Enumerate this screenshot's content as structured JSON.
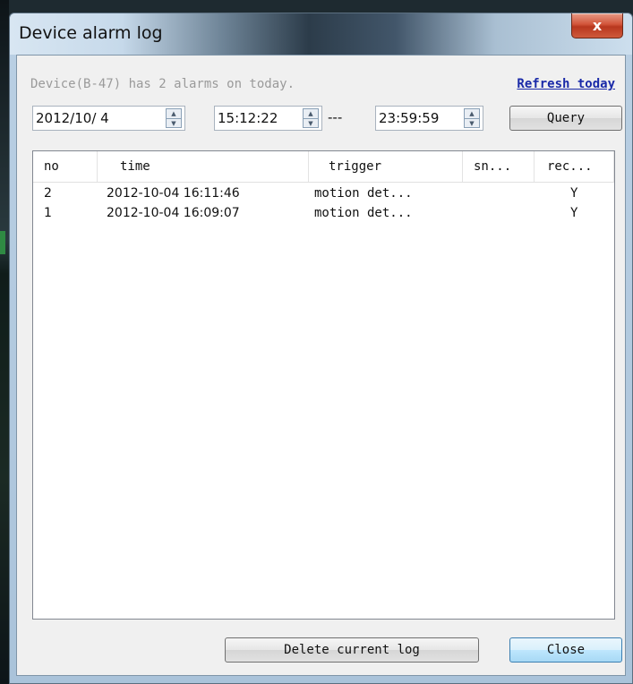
{
  "window": {
    "title": "Device alarm log",
    "close_glyph": "x"
  },
  "info": {
    "summary": "Device(B-47) has 2 alarms on today.",
    "refresh_link": "Refresh today"
  },
  "query": {
    "date": "2012/10/ 4",
    "start_time": "15:12:22",
    "separator": "---",
    "end_time": "23:59:59",
    "query_button": "Query"
  },
  "table": {
    "columns": [
      "no",
      "time",
      "trigger",
      "sn...",
      "rec..."
    ],
    "rows": [
      {
        "no": "2",
        "time": "2012-10-04 16:11:46",
        "trigger": "motion det...",
        "sn": "",
        "rec": "Y"
      },
      {
        "no": "1",
        "time": "2012-10-04 16:09:07",
        "trigger": "motion det...",
        "sn": "",
        "rec": "Y"
      }
    ]
  },
  "footer": {
    "delete_button": "Delete current log",
    "close_button": "Close"
  },
  "icons": {
    "spin_up": "up-arrow-icon",
    "spin_down": "down-arrow-icon",
    "close": "close-icon"
  },
  "colors": {
    "link": "#1a2aa8",
    "close_button": "#c8472b",
    "info_text": "#9a9a9a"
  }
}
